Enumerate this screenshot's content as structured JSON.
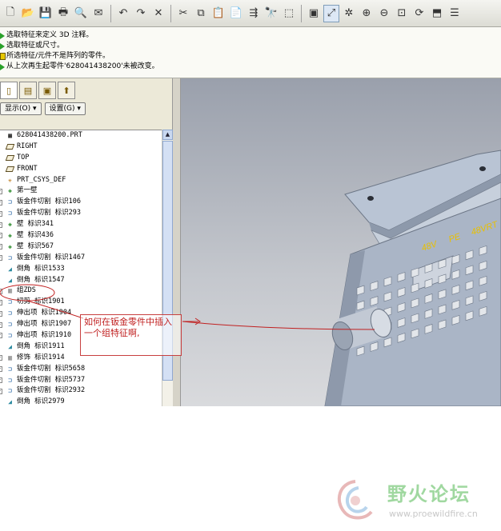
{
  "toolbar": {
    "buttons": [
      "new-icon",
      "open-icon",
      "save-icon",
      "print-icon",
      "print-preview-icon",
      "email-icon",
      "undo-icon",
      "redo-icon",
      "close-icon",
      "cut-icon",
      "copy-icon",
      "paste-icon",
      "paste-special-icon",
      "regenerate-icon",
      "find-icon",
      "select-box-icon",
      "refit-icon",
      "datum-axis-icon",
      "spin-center-icon",
      "zoom-in-icon",
      "zoom-out-icon",
      "zoom-fit-icon",
      "repaint-icon",
      "orient-icon",
      "saved-views-icon"
    ]
  },
  "messages": [
    {
      "icon": "arrow",
      "text": "选取特征来定义 3D 注释。"
    },
    {
      "icon": "arrow",
      "text": "选取特征或尺寸。"
    },
    {
      "icon": "warn",
      "text": "所选特征/元件不是阵列的零件。"
    },
    {
      "icon": "arrow",
      "text": "从上次再生起零件'628041438200'未被改变。"
    }
  ],
  "panel": {
    "show_label": "显示(O)",
    "settings_label": "设置(G)"
  },
  "tree": [
    {
      "icon": "part",
      "label": "628041438200.PRT",
      "expander": ""
    },
    {
      "icon": "plane",
      "label": "RIGHT",
      "expander": ""
    },
    {
      "icon": "plane",
      "label": "TOP",
      "expander": ""
    },
    {
      "icon": "plane",
      "label": "FRONT",
      "expander": ""
    },
    {
      "icon": "csys",
      "label": "PRT_CSYS_DEF",
      "expander": ""
    },
    {
      "icon": "wall",
      "label": "第一壁",
      "expander": "+"
    },
    {
      "icon": "cut",
      "label": "钣金件切割 标识106",
      "expander": "+"
    },
    {
      "icon": "cut",
      "label": "钣金件切割 标识293",
      "expander": "+"
    },
    {
      "icon": "wall",
      "label": "壁 标识341",
      "expander": "+"
    },
    {
      "icon": "wall",
      "label": "壁 标识436",
      "expander": "+"
    },
    {
      "icon": "wall",
      "label": "壁 标识567",
      "expander": "+"
    },
    {
      "icon": "cut",
      "label": "钣金件切割 标识1467",
      "expander": "+"
    },
    {
      "icon": "round",
      "label": "倒角 标识1533",
      "expander": ""
    },
    {
      "icon": "round",
      "label": "倒角 标识1547",
      "expander": ""
    },
    {
      "icon": "group",
      "label": "组ZDS",
      "expander": "+"
    },
    {
      "icon": "cut",
      "label": "切剪 标识1901",
      "expander": "+"
    },
    {
      "icon": "cut",
      "label": "伸出项 标识1904",
      "expander": "+"
    },
    {
      "icon": "cut",
      "label": "伸出项 标识1907",
      "expander": "+"
    },
    {
      "icon": "cut",
      "label": "伸出项 标识1910",
      "expander": "+"
    },
    {
      "icon": "round",
      "label": "倒角 标识1911",
      "expander": ""
    },
    {
      "icon": "group",
      "label": "修饰 标识1914",
      "expander": "+"
    },
    {
      "icon": "cut",
      "label": "钣金件切割 标识5658",
      "expander": "+"
    },
    {
      "icon": "cut",
      "label": "钣金件切割 标识5737",
      "expander": "+"
    },
    {
      "icon": "cut",
      "label": "钣金件切割 标识2932",
      "expander": "+"
    },
    {
      "icon": "round",
      "label": "倒角 标识2979",
      "expander": ""
    }
  ],
  "model": {
    "label_1": "48V",
    "label_2": "PE",
    "label_3": "48VRT",
    "label_color": "#e8c000"
  },
  "annotation": {
    "text": "如何在钣金零件中插入一个组特征啊,",
    "color": "#c02020"
  },
  "watermark": {
    "title": "野火论坛",
    "url": "www.proewildfire.cn"
  }
}
